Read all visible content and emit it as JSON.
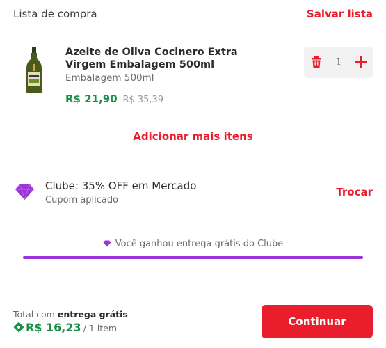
{
  "header": {
    "title": "Lista de compra",
    "save_label": "Salvar lista"
  },
  "item": {
    "name": "Azeite de Oliva Cocinero Extra Virgem Embalagem 500ml",
    "description": "Embalagem 500ml",
    "price": "R$ 21,90",
    "old_price": "R$ 35,39",
    "quantity": "1"
  },
  "add_more_label": "Adicionar mais itens",
  "club": {
    "title": "Clube: 35% OFF em Mercado",
    "subtitle": "Cupom aplicado",
    "swap_label": "Trocar",
    "free_delivery_text": "Você ganhou entrega grátis do Clube",
    "free_delivery_progress": 1.0
  },
  "footer": {
    "total_prefix": "Total com",
    "total_bold": "entrega grátis",
    "total_price": "R$ 16,23",
    "item_count": "/ 1 item",
    "continue_label": "Continuar"
  },
  "colors": {
    "accent": "#ea1d2c",
    "price_green": "#1b8f4a",
    "club_purple": "#9a35d6"
  },
  "icons": {
    "trash": "trash-icon",
    "plus": "plus-icon",
    "gem": "gem-icon",
    "tag": "tag-icon"
  }
}
